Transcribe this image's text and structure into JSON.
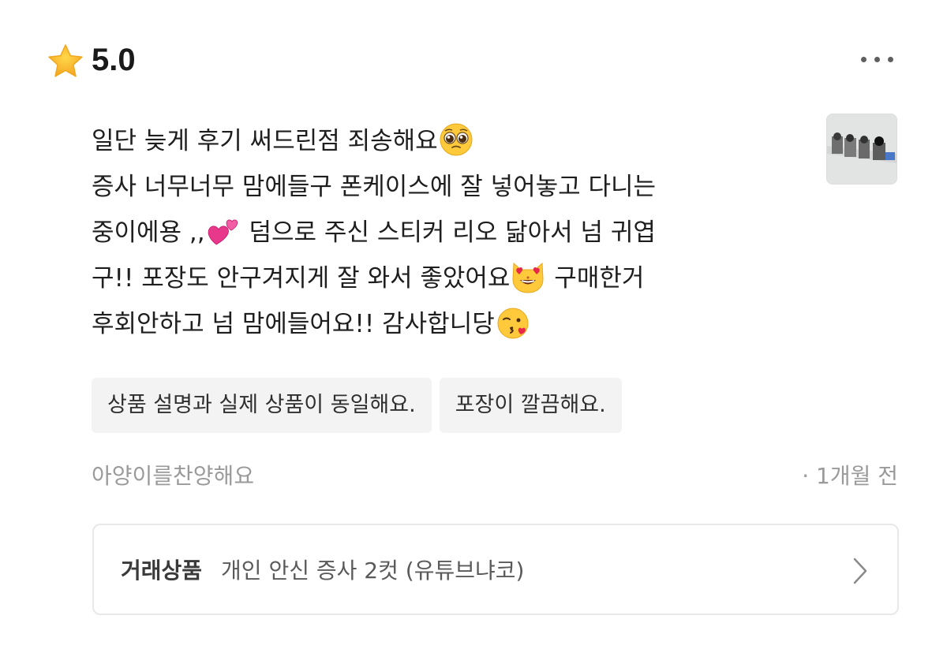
{
  "review": {
    "rating": "5.0",
    "lines": [
      {
        "text": "일단 늦게 후기 써드린점 죄송해요",
        "emoji": "pleading-face"
      },
      {
        "text": "증사 너무너무 맘에들구 폰케이스에 잘 넣어놓고 다니는"
      },
      {
        "text_before": "중이에용 ,,",
        "emoji": "two-hearts",
        "text_after": " 덤으로 주신 스티커 리오 닮아서 넘 귀엽"
      },
      {
        "text_before": "구!! 포장도 안구겨지게 잘 와서 좋았어요",
        "emoji": "heart-eyes-cat",
        "text_after": " 구매한거"
      },
      {
        "text": "후회안하고 넘 맘에들어요!! 감사합니당",
        "emoji": "kissing-face"
      }
    ],
    "tags": [
      "상품 설명과 실제 상품이 동일해요.",
      "포장이 깔끔해요."
    ],
    "author": "아양이를찬양해요",
    "time": "· 1개월 전",
    "product": {
      "label": "거래상품",
      "name": "개인 안신 증사 2컷 (유튜브냐코)"
    }
  },
  "icons": {
    "rating": "star-icon",
    "menu": "more-options-icon",
    "product": "chevron-right-icon"
  },
  "colors": {
    "star": "#FDBF2D",
    "text": "#1E1E1E",
    "muted": "#9A9A9A",
    "tag_bg": "#F3F3F3",
    "border": "#E8E8E8"
  }
}
